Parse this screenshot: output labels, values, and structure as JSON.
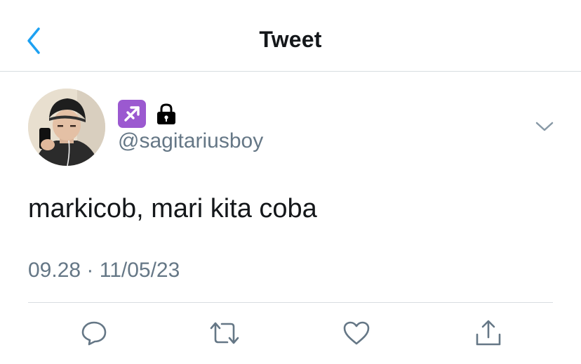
{
  "header": {
    "title": "Tweet",
    "back_icon": "chevron-left-icon",
    "accent_color": "#1da1f2"
  },
  "tweet": {
    "badges": [
      "sagittarius-emoji-icon",
      "lock-icon"
    ],
    "handle": "@sagitariusboy",
    "text": "markicob, mari kita coba",
    "timestamp": "09.28 · 11/05/23"
  },
  "actions": [
    "reply-icon",
    "retweet-icon",
    "like-icon",
    "share-icon"
  ],
  "colors": {
    "text": "#14171a",
    "secondary": "#657786",
    "divider": "#d8dde1",
    "zodiac_bg": "#9b59d0"
  }
}
